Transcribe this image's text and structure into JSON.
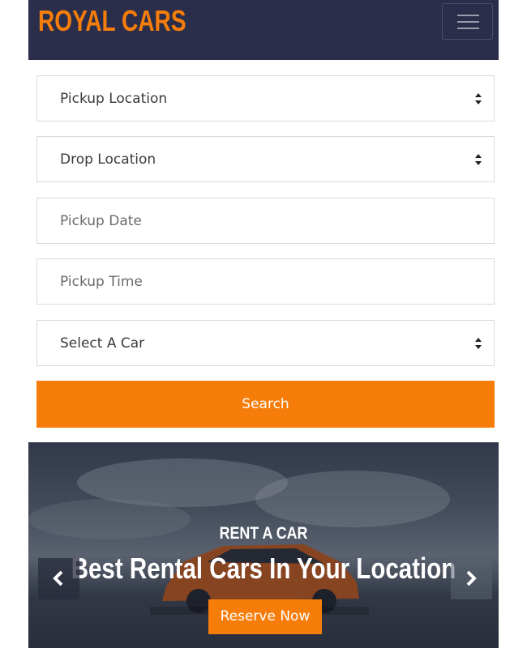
{
  "navbar": {
    "brand": "ROYAL CARS",
    "menu_icon": "hamburger-icon"
  },
  "form": {
    "pickup_location": "Pickup Location",
    "drop_location": "Drop Location",
    "pickup_date_placeholder": "Pickup Date",
    "pickup_time_placeholder": "Pickup Time",
    "select_car": "Select A Car",
    "search_label": "Search"
  },
  "carousel": {
    "kicker": "RENT A CAR",
    "headline": "Best Rental Cars In Your Location",
    "reserve_label": "Reserve Now",
    "prev_icon": "chevron-left-icon",
    "next_icon": "chevron-right-icon"
  },
  "colors": {
    "accent": "#f77d0a",
    "navbar_bg": "#2b2e4a"
  }
}
